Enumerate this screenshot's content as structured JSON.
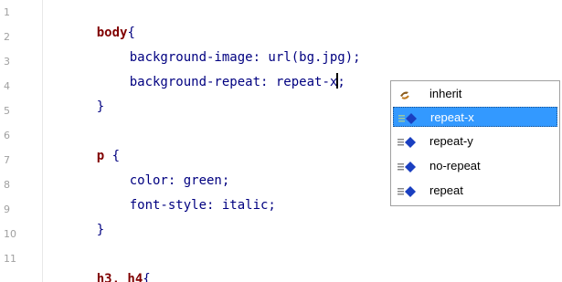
{
  "editor": {
    "line_numbers": [
      "1",
      "2",
      "3",
      "4",
      "5",
      "6",
      "7",
      "8",
      "9",
      "10",
      "11"
    ],
    "lines": {
      "l1_selector": "body",
      "l1_brace": "{",
      "l2_text": "background-image: url(bg.jpg);",
      "l3_prop": "background-repeat: ",
      "l3_value_before_caret": "repeat-x",
      "l3_value_after_caret": ";",
      "l4_brace": "}",
      "l6_selector": "p",
      "l6_brace": " {",
      "l7_text": "color: green;",
      "l8_text": "font-style: italic;",
      "l9_brace": "}",
      "l11_selector": "h3, h4",
      "l11_brace": "{"
    }
  },
  "autocomplete": {
    "items": [
      {
        "label": "inherit",
        "icon": "inherit-icon"
      },
      {
        "label": "repeat-x",
        "icon": "value-icon",
        "selected": true
      },
      {
        "label": "repeat-y",
        "icon": "value-icon"
      },
      {
        "label": "no-repeat",
        "icon": "value-icon"
      },
      {
        "label": "repeat",
        "icon": "value-icon"
      }
    ]
  },
  "colors": {
    "selector": "#800000",
    "code": "#000080",
    "selection": "#3399ff",
    "line_number": "#a0a0a0"
  }
}
